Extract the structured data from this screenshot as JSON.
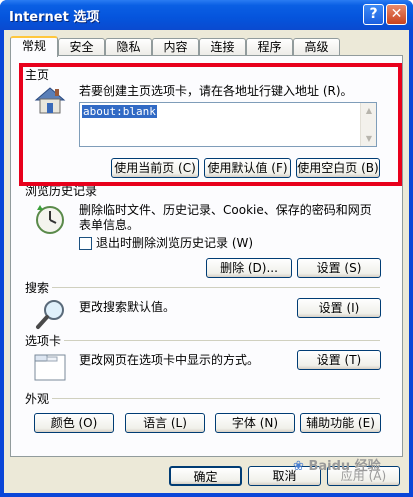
{
  "window": {
    "title": "Internet 选项",
    "help_glyph": "?",
    "close_glyph": "✕"
  },
  "tabs": [
    {
      "label": "常规"
    },
    {
      "label": "安全"
    },
    {
      "label": "隐私"
    },
    {
      "label": "内容"
    },
    {
      "label": "连接"
    },
    {
      "label": "程序"
    },
    {
      "label": "高级"
    }
  ],
  "home": {
    "group_label": "主页",
    "description": "若要创建主页选项卡，请在各地址行键入地址 (R)。",
    "address_value": "about:blank",
    "btn_current": "使用当前页 (C)",
    "btn_default": "使用默认值 (F)",
    "btn_blank": "使用空白页 (B)"
  },
  "history": {
    "group_label": "浏览历史记录",
    "description_1": "删除临时文件、历史记录、Cookie、保存的密码和网页",
    "description_2": "表单信息。",
    "checkbox_label": "退出时删除浏览历史记录 (W)",
    "btn_delete": "删除 (D)...",
    "btn_settings": "设置 (S)"
  },
  "search": {
    "group_label": "搜索",
    "description": "更改搜索默认值。",
    "btn_settings": "设置 (I)"
  },
  "tabbed": {
    "group_label": "选项卡",
    "description": "更改网页在选项卡中显示的方式。",
    "btn_settings": "设置 (T)"
  },
  "appearance": {
    "group_label": "外观",
    "btn_colors": "颜色 (O)",
    "btn_languages": "语言 (L)",
    "btn_fonts": "字体 (N)",
    "btn_accessibility": "辅助功能 (E)"
  },
  "footer": {
    "ok": "确定",
    "cancel": "取消",
    "apply": "应用 (A)"
  },
  "watermark": "Baidu 经验",
  "colors": {
    "highlight": "#e8001c",
    "titlebar": "#0554dc",
    "panel": "#fcfcfe"
  }
}
